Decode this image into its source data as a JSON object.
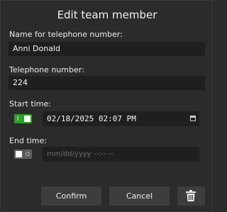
{
  "dialog": {
    "title": "Edit team member",
    "name_label": "Name for telephone number:",
    "name_value": "Anni Donald",
    "phone_label": "Telephone number:",
    "phone_value": "224",
    "start": {
      "label": "Start time:",
      "toggle_on": true,
      "toggle_mark": "I",
      "value": "02/18/2025 02:07 PM"
    },
    "end": {
      "label": "End time:",
      "toggle_on": false,
      "toggle_mark": "O",
      "placeholder": "mm/dd/yyyy --:-- --"
    },
    "buttons": {
      "confirm": "Confirm",
      "cancel": "Cancel"
    }
  },
  "colors": {
    "background": "#2b2b2b",
    "field": "#1f1f1f",
    "toggle_on": "#2f9e2f",
    "button": "#3d3d3d"
  },
  "icons": {
    "delete": "trash-icon",
    "calendar": "calendar-icon"
  }
}
